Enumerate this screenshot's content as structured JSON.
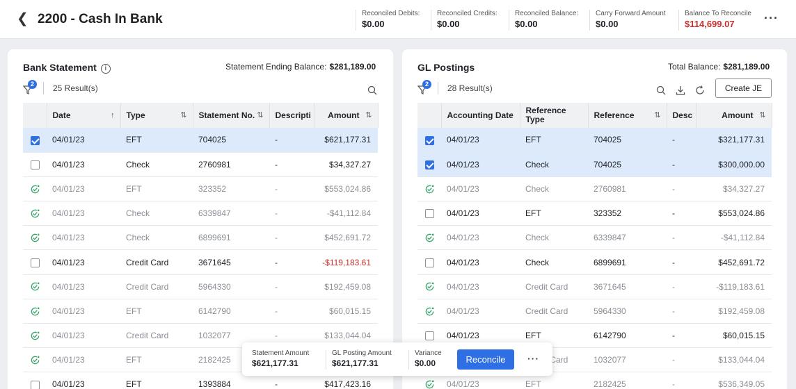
{
  "header": {
    "title": "2200 - Cash In Bank",
    "metrics": [
      {
        "label": "Reconciled Debits:",
        "value": "$0.00"
      },
      {
        "label": "Reconciled Credits:",
        "value": "$0.00"
      },
      {
        "label": "Reconciled Balance:",
        "value": "$0.00"
      },
      {
        "label": "Carry Forward Amount",
        "value": "$0.00"
      },
      {
        "label": "Balance To Reconcile",
        "value": "$114,699.07"
      }
    ]
  },
  "bank": {
    "title": "Bank Statement",
    "balance_label": "Statement Ending Balance:",
    "balance_value": "$281,189.00",
    "filter_count": "2",
    "results": "25 Result(s)",
    "columns": [
      "Date",
      "Type",
      "Statement No.",
      "Descripti",
      "Amount"
    ],
    "rows": [
      {
        "date": "04/01/23",
        "type": "EFT",
        "no": "704025",
        "desc": "-",
        "amount": "$621,177.31",
        "state": "selected"
      },
      {
        "date": "04/01/23",
        "type": "Check",
        "no": "2760981",
        "desc": "-",
        "amount": "$34,327.27",
        "state": "open"
      },
      {
        "date": "04/01/23",
        "type": "EFT",
        "no": "323352",
        "desc": "-",
        "amount": "$553,024.86",
        "state": "reconciled"
      },
      {
        "date": "04/01/23",
        "type": "Check",
        "no": "6339847",
        "desc": "-",
        "amount": "-$41,112.84",
        "state": "reconciled"
      },
      {
        "date": "04/01/23",
        "type": "Check",
        "no": "6899691",
        "desc": "-",
        "amount": "$452,691.72",
        "state": "reconciled"
      },
      {
        "date": "04/01/23",
        "type": "Credit Card",
        "no": "3671645",
        "desc": "-",
        "amount": "-$119,183.61",
        "state": "open"
      },
      {
        "date": "04/01/23",
        "type": "Credit Card",
        "no": "5964330",
        "desc": "-",
        "amount": "$192,459.08",
        "state": "reconciled"
      },
      {
        "date": "04/01/23",
        "type": "EFT",
        "no": "6142790",
        "desc": "-",
        "amount": "$60,015.15",
        "state": "reconciled"
      },
      {
        "date": "04/01/23",
        "type": "Credit Card",
        "no": "1032077",
        "desc": "-",
        "amount": "$133,044.04",
        "state": "reconciled"
      },
      {
        "date": "04/01/23",
        "type": "EFT",
        "no": "2182425",
        "desc": "-",
        "amount": "$536,349.05",
        "state": "reconciled"
      },
      {
        "date": "04/01/23",
        "type": "EFT",
        "no": "1393884",
        "desc": "-",
        "amount": "$417,423.16",
        "state": "open"
      }
    ]
  },
  "gl": {
    "title": "GL Postings",
    "balance_label": "Total Balance:",
    "balance_value": "$281,189.00",
    "filter_count": "2",
    "results": "28 Result(s)",
    "create_label": "Create JE",
    "columns": [
      "Accounting Date",
      "Reference Type",
      "Reference",
      "Desc",
      "Amount"
    ],
    "rows": [
      {
        "date": "04/01/23",
        "type": "EFT",
        "ref": "704025",
        "desc": "-",
        "amount": "$321,177.31",
        "state": "selected"
      },
      {
        "date": "04/01/23",
        "type": "Check",
        "ref": "704025",
        "desc": "-",
        "amount": "$300,000.00",
        "state": "selected"
      },
      {
        "date": "04/01/23",
        "type": "Check",
        "ref": "2760981",
        "desc": "-",
        "amount": "$34,327.27",
        "state": "reconciled"
      },
      {
        "date": "04/01/23",
        "type": "EFT",
        "ref": "323352",
        "desc": "-",
        "amount": "$553,024.86",
        "state": "open"
      },
      {
        "date": "04/01/23",
        "type": "Check",
        "ref": "6339847",
        "desc": "-",
        "amount": "-$41,112.84",
        "state": "reconciled"
      },
      {
        "date": "04/01/23",
        "type": "Check",
        "ref": "6899691",
        "desc": "-",
        "amount": "$452,691.72",
        "state": "open"
      },
      {
        "date": "04/01/23",
        "type": "Credit Card",
        "ref": "3671645",
        "desc": "-",
        "amount": "-$119,183.61",
        "state": "reconciled"
      },
      {
        "date": "04/01/23",
        "type": "Credit Card",
        "ref": "5964330",
        "desc": "-",
        "amount": "$192,459.08",
        "state": "reconciled"
      },
      {
        "date": "04/01/23",
        "type": "EFT",
        "ref": "6142790",
        "desc": "-",
        "amount": "$60,015.15",
        "state": "open"
      },
      {
        "date": "04/01/23",
        "type": "Credit Card",
        "ref": "1032077",
        "desc": "-",
        "amount": "$133,044.04",
        "state": "reconciled"
      },
      {
        "date": "04/01/23",
        "type": "EFT",
        "ref": "2182425",
        "desc": "-",
        "amount": "$536,349.05",
        "state": "reconciled"
      }
    ]
  },
  "footer_bar": {
    "statement_label": "Statement Amount",
    "statement_value": "$621,177.31",
    "gl_label": "GL Posting Amount",
    "gl_value": "$621,177.31",
    "variance_label": "Variance",
    "variance_value": "$0.00",
    "reconcile_label": "Reconcile"
  },
  "colors": {
    "accent": "#2f6fe4",
    "negative": "#c8302d",
    "reconciled": "#3aa66a",
    "selected_row": "#dceafc"
  }
}
